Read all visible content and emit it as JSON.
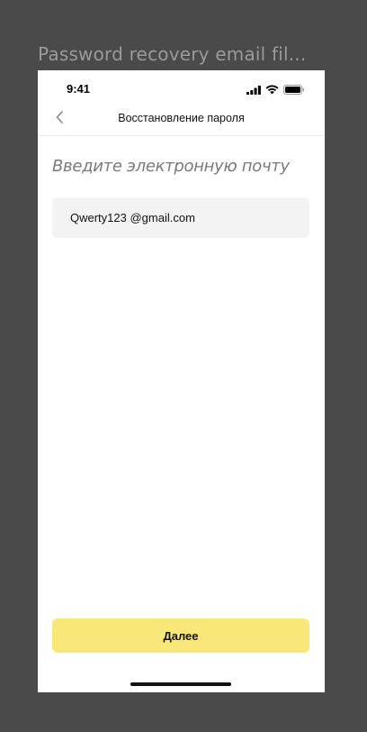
{
  "frame": {
    "label": "Password recovery email fil..."
  },
  "status_bar": {
    "time": "9:41",
    "icons": [
      "signal-icon",
      "wifi-icon",
      "battery-icon"
    ]
  },
  "nav": {
    "back_icon": "chevron-left-icon",
    "title": "Восстановление пароля"
  },
  "form": {
    "prompt": "Введите электронную почту",
    "email_value": "Qwerty123 @gmail.com"
  },
  "actions": {
    "next_label": "Далее"
  },
  "colors": {
    "background": "#4a4a4a",
    "screen": "#ffffff",
    "field_bg": "#f3f3f3",
    "button_bg": "#fae77a",
    "prompt_text": "#7a7a7a"
  }
}
